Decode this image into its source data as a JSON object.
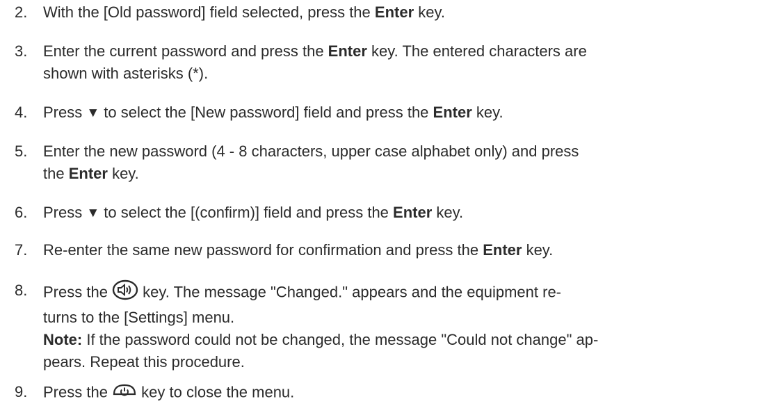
{
  "steps": [
    {
      "num": "2.",
      "t1": "With the [Old password] field selected, press the ",
      "b1": "Enter",
      "t2": " key."
    },
    {
      "num": "3.",
      "t1": "Enter the current password and press the ",
      "b1": "Enter",
      "t2": " key. The entered characters are",
      "line2": "shown with asterisks (*)."
    },
    {
      "num": "4.",
      "t1": "Press ",
      "sym": "▼",
      "t2": " to select the [New password] field and press the ",
      "b1": "Enter",
      "t3": " key."
    },
    {
      "num": "5.",
      "t1": "Enter the new password (4 - 8 characters, upper case alphabet only) and press",
      "l2a": "the ",
      "b1": "Enter",
      "l2b": " key."
    },
    {
      "num": "6.",
      "t1": "Press ",
      "sym": "▼",
      "t2": " to select the [(confirm)] field and press the ",
      "b1": "Enter",
      "t3": " key."
    },
    {
      "num": "7.",
      "t1": "Re-enter the same new password for confirmation and press the ",
      "b1": "Enter",
      "t2": " key."
    },
    {
      "num": "8.",
      "t1": "Press the ",
      "t2": " key. The message \"Changed.\" appears and the equipment re-",
      "line2": "turns to the [Settings] menu.",
      "note_label": "Note:",
      "note_text": " If the password could not be changed, the message \"Could not change\" ap-",
      "note_line2": "pears. Repeat this procedure."
    },
    {
      "num": "9.",
      "t1": "Press the ",
      "t2": " key to close the menu."
    }
  ],
  "icons": {
    "speaker_key": "speaker-key-icon",
    "power_key": "power-key-icon"
  }
}
